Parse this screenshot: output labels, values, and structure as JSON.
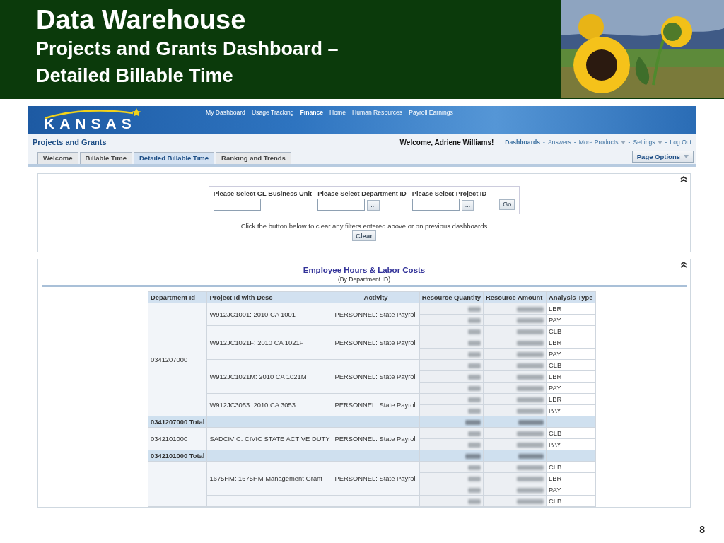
{
  "slide": {
    "title": "Data Warehouse",
    "subtitle_lines": [
      "Projects and Grants Dashboard –",
      "Detailed Billable Time"
    ],
    "picture": {
      "kind": "picture"
    },
    "page_number": "8"
  },
  "app": {
    "logo": "KANSAS",
    "nav": [
      {
        "label": "My Dashboard",
        "selected": false
      },
      {
        "label": "Usage Tracking",
        "selected": false
      },
      {
        "label": "Finance",
        "selected": true
      },
      {
        "label": "Home",
        "selected": false
      },
      {
        "label": "Human Resources",
        "selected": false
      },
      {
        "label": "Payroll Earnings",
        "selected": false
      }
    ],
    "dashboard_title": "Projects and Grants",
    "welcome": "Welcome, Adriene Williams!",
    "link_separator": "-",
    "header_links": [
      {
        "label": "Dashboards",
        "dropdown": false,
        "selected": true
      },
      {
        "label": "Answers",
        "dropdown": false,
        "selected": false
      },
      {
        "label": "More Products",
        "dropdown": true,
        "selected": false
      },
      {
        "label": "Settings",
        "dropdown": true,
        "selected": false
      },
      {
        "label": "Log Out",
        "dropdown": false,
        "selected": false
      }
    ],
    "tabs": [
      {
        "label": "Welcome",
        "selected": false
      },
      {
        "label": "Billable Time",
        "selected": false
      },
      {
        "label": "Detailed Billable Time",
        "selected": true
      },
      {
        "label": "Ranking and Trends",
        "selected": false
      }
    ],
    "page_options": "Page Options",
    "filters": {
      "prompts": [
        {
          "label": "Please Select GL Business Unit"
        },
        {
          "label": "Please Select Department ID",
          "browse": "..."
        },
        {
          "label": "Please Select Project ID",
          "browse": "..."
        }
      ],
      "go": "Go",
      "note": "Click the button below to clear any filters entered above or on previous dashboards",
      "clear": "Clear"
    },
    "report": {
      "title": "Employee Hours & Labor Costs",
      "subtitle": "(By Department ID)",
      "columns": [
        "Department Id",
        "Project Id with Desc",
        "Activity",
        "Resource Quantity",
        "Resource Amount",
        "Analysis Type"
      ],
      "groups": [
        {
          "department": "0341207000",
          "total": "0341207000 Total",
          "projects": [
            {
              "project": "W912JC1001: 2010 CA 1001",
              "activity": "PERSONNEL: State Payroll",
              "lines": [
                "LBR",
                "PAY"
              ]
            },
            {
              "project": "W912JC1021F: 2010 CA 1021F",
              "activity": "PERSONNEL: State Payroll",
              "lines": [
                "CLB",
                "LBR",
                "PAY"
              ]
            },
            {
              "project": "W912JC1021M: 2010 CA 1021M",
              "activity": "PERSONNEL: State Payroll",
              "lines": [
                "CLB",
                "LBR",
                "PAY"
              ]
            },
            {
              "project": "W912JC3053: 2010 CA 3053",
              "activity": "PERSONNEL: State Payroll",
              "lines": [
                "LBR",
                "PAY"
              ]
            }
          ]
        },
        {
          "department": "0342101000",
          "total": "0342101000 Total",
          "projects": [
            {
              "project": "SADCIVIC: CIVIC STATE ACTIVE DUTY",
              "activity": "PERSONNEL: State Payroll",
              "lines": [
                "CLB",
                "PAY"
              ]
            }
          ]
        },
        {
          "projects": [
            {
              "project": "1675HM: 1675HM Management Grant",
              "activity": "PERSONNEL: State Payroll",
              "lines": [
                "CLB",
                "LBR",
                "PAY"
              ]
            },
            {
              "lines": [
                "CLB"
              ]
            }
          ]
        }
      ]
    }
  }
}
